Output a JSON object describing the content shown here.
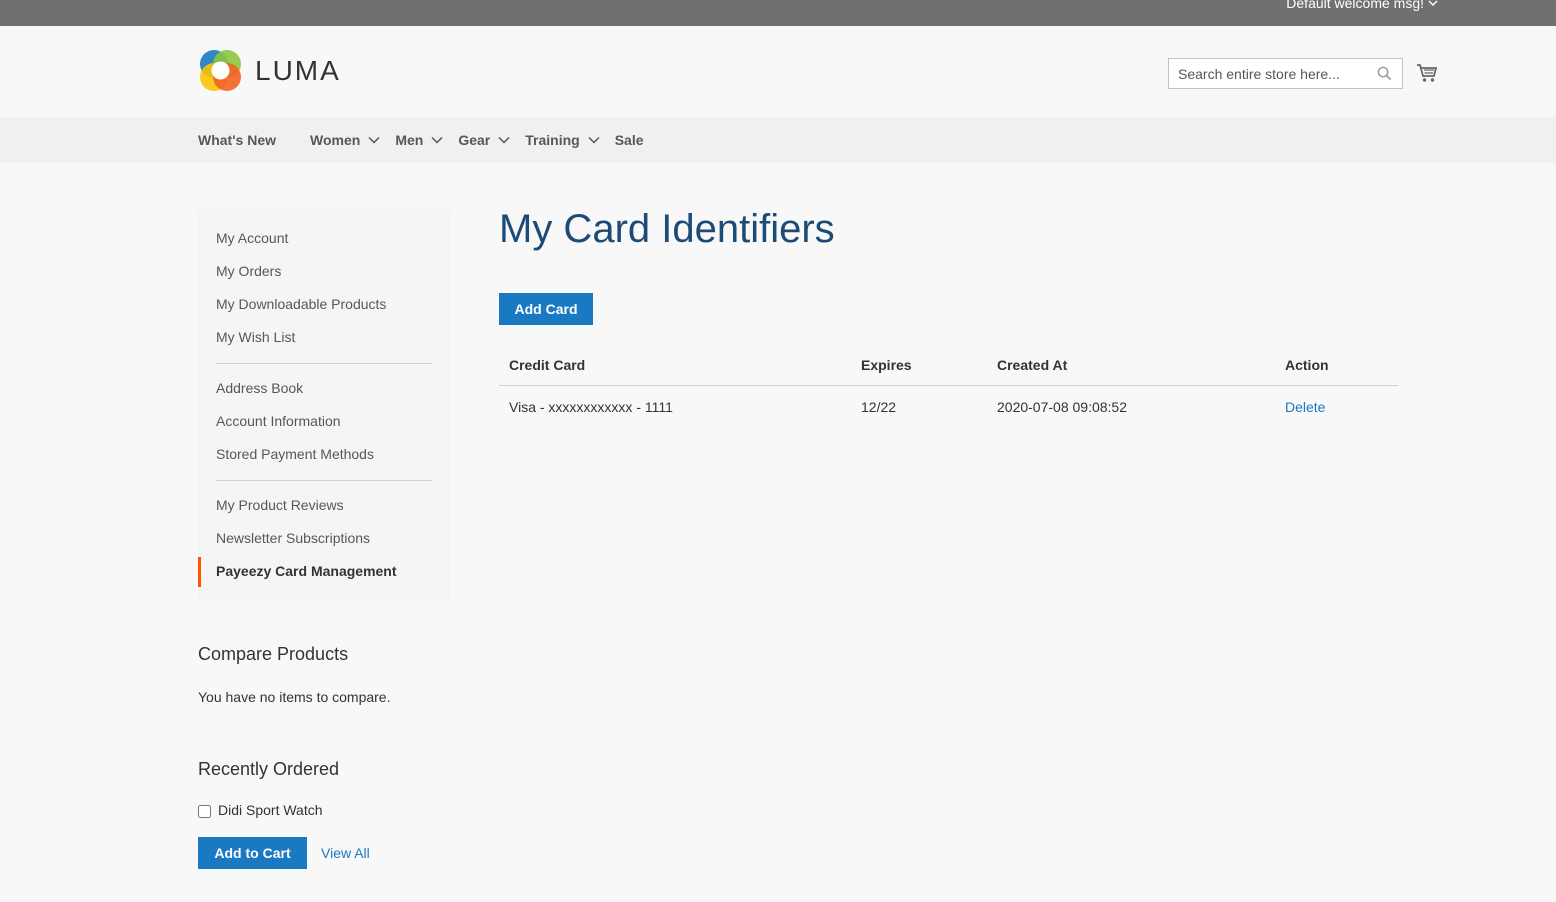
{
  "topbar": {
    "welcome": "Default welcome msg!"
  },
  "header": {
    "logo_text": "LUMA",
    "search_placeholder": "Search entire store here..."
  },
  "nav": [
    {
      "label": "What's New",
      "dropdown": false
    },
    {
      "label": "Women",
      "dropdown": true
    },
    {
      "label": "Men",
      "dropdown": true
    },
    {
      "label": "Gear",
      "dropdown": true
    },
    {
      "label": "Training",
      "dropdown": true
    },
    {
      "label": "Sale",
      "dropdown": false
    }
  ],
  "sidebar": {
    "groups": [
      [
        "My Account",
        "My Orders",
        "My Downloadable Products",
        "My Wish List"
      ],
      [
        "Address Book",
        "Account Information",
        "Stored Payment Methods"
      ],
      [
        "My Product Reviews",
        "Newsletter Subscriptions",
        "Payeezy Card Management"
      ]
    ],
    "active": "Payeezy Card Management"
  },
  "compare": {
    "title": "Compare Products",
    "empty": "You have no items to compare."
  },
  "recent": {
    "title": "Recently Ordered",
    "item": "Didi Sport Watch",
    "add_to_cart": "Add to Cart",
    "view_all": "View All"
  },
  "main": {
    "title": "My Card Identifiers",
    "add_card": "Add Card",
    "table": {
      "headers": [
        "Credit Card",
        "Expires",
        "Created At",
        "Action"
      ],
      "rows": [
        {
          "card": "Visa - xxxxxxxxxxxx - 1111",
          "expires": "12/22",
          "created": "2020-07-08 09:08:52",
          "action": "Delete"
        }
      ]
    }
  },
  "colors": {
    "accent": "#1979c3",
    "title": "#1d4b77",
    "active_bar": "#ff5501"
  }
}
